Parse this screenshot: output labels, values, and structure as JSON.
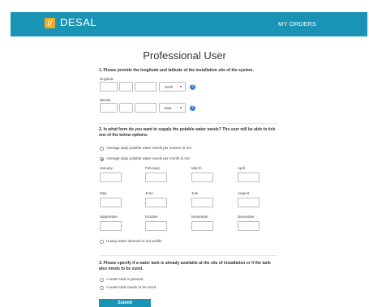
{
  "header": {
    "brand": "DESAL",
    "my_orders": "MY ORDERS",
    "accent_color": "#1a94b4",
    "logo_color": "#f2a81d"
  },
  "page_title": "Professional User",
  "q1": {
    "text": "1. Please provide the longitude and latitude of the installation site of the system.",
    "longitude_label": "longitude",
    "longitude_dir": "North",
    "latitude_label": "latitude",
    "latitude_dir": "East"
  },
  "q2": {
    "text": "2. In what form do you want to supply the potable water needs? The user will be able to tick one of the below options:",
    "options": [
      "Average daily potable water needs per season in m3",
      "Average daily potable water needs per month in m3",
      "Hourly water demand in m3 profile"
    ],
    "selected_option": 1,
    "months": [
      "January",
      "February",
      "March",
      "April",
      "May",
      "June",
      "Jule",
      "August",
      "September",
      "October",
      "November",
      "December"
    ]
  },
  "q3": {
    "text": "3. Please specify if a water tank is already available at the site of installation or if the tank also needs to be sized.",
    "options": [
      "A water tank is present.",
      "A water tank needs to be sized."
    ]
  },
  "submit_label": "Submit"
}
